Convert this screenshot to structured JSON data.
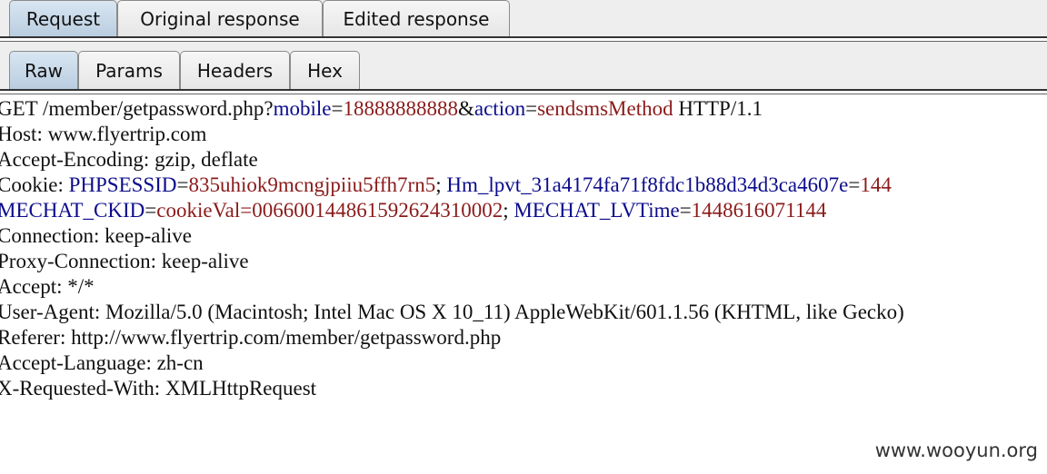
{
  "tabs": [
    {
      "label": "Request",
      "active": true
    },
    {
      "label": "Original response",
      "active": false
    },
    {
      "label": "Edited response",
      "active": false
    }
  ],
  "subtabs": [
    {
      "label": "Raw",
      "active": true
    },
    {
      "label": "Params",
      "active": false
    },
    {
      "label": "Headers",
      "active": false
    },
    {
      "label": "Hex",
      "active": false
    }
  ],
  "request": {
    "line1": {
      "method_path": "GET /member/getpassword.php?",
      "p1_key": "mobile",
      "eq1": "=",
      "p1_val": "18888888888",
      "amp": "&",
      "p2_key": "action",
      "eq2": "=",
      "p2_val": "sendsmsMethod",
      "proto": " HTTP/1.1"
    },
    "host": "Host: www.flyertrip.com",
    "accept_encoding": "Accept-Encoding: gzip, deflate",
    "cookie": {
      "prefix": "Cookie: ",
      "c1_key": "PHPSESSID",
      "eq1": "=",
      "c1_val": "835uhiok9mcngjpiiu5ffh7rn5",
      "sep1": "; ",
      "c2_key": "Hm_lpvt_31a4174fa71f8fdc1b88d34d3ca4607e",
      "eq2": "=",
      "c2_val": "144",
      "c3_key": "MECHAT_CKID",
      "eq3": "=",
      "c3_val": "cookieVal=006600144861592624310002",
      "sep2": "; ",
      "c4_key": "MECHAT_LVTime",
      "eq4": "=",
      "c4_val": "1448616071144"
    },
    "connection": "Connection: keep-alive",
    "proxy_connection": "Proxy-Connection: keep-alive",
    "accept": "Accept: */*",
    "user_agent": "User-Agent: Mozilla/5.0 (Macintosh; Intel Mac OS X 10_11) AppleWebKit/601.1.56 (KHTML, like Gecko)",
    "referer": "Referer: http://www.flyertrip.com/member/getpassword.php",
    "accept_language": "Accept-Language: zh-cn",
    "x_requested_with": "X-Requested-With: XMLHttpRequest"
  },
  "watermark": "www.wooyun.org",
  "colors": {
    "key": "#0b0b8c",
    "value": "#8b1a1a",
    "active_tab": "#c6d8ea"
  }
}
